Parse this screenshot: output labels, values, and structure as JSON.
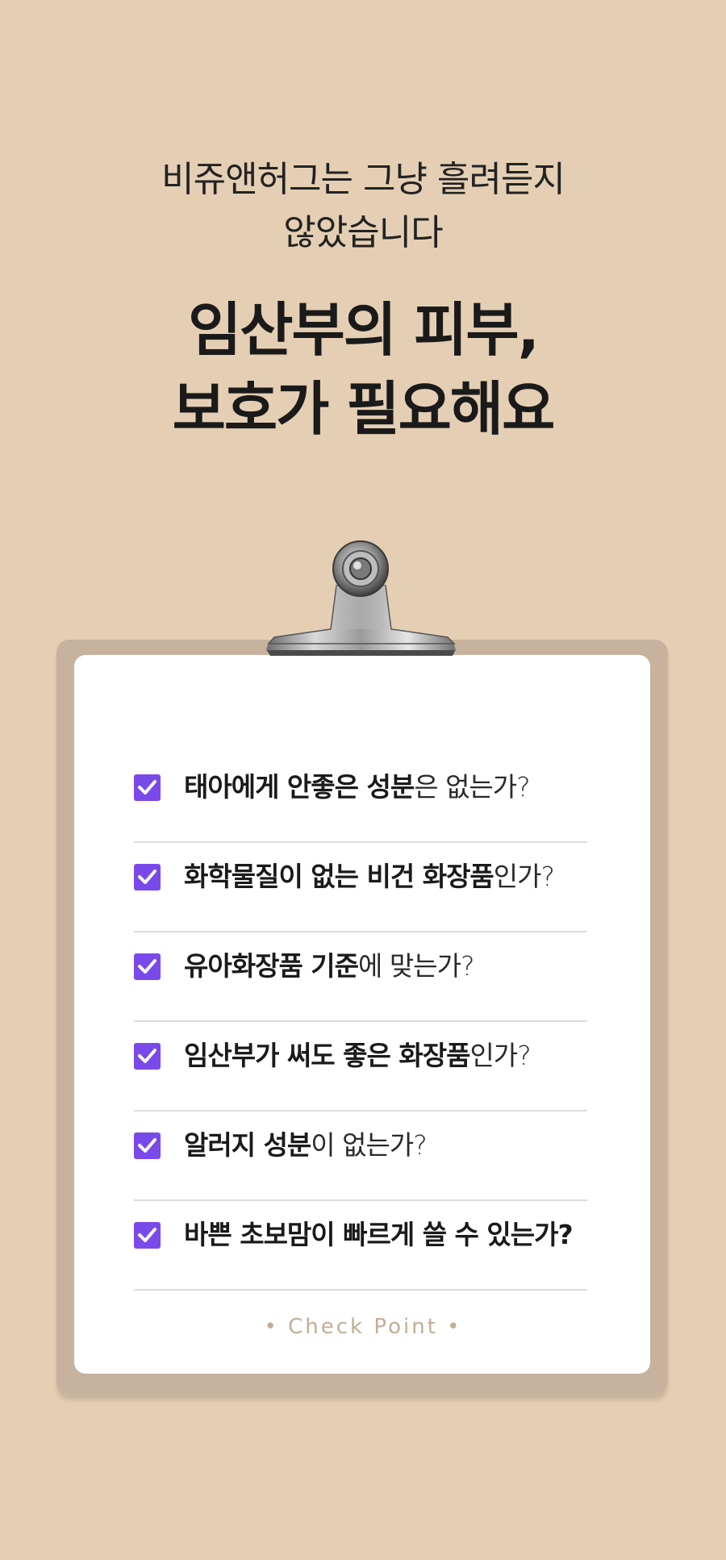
{
  "intro": {
    "line1": "비쥬앤허그는 그냥 흘려듣지",
    "line2": "않았습니다"
  },
  "headline": {
    "line1": "임산부의 피부,",
    "line2": "보호가 필요해요"
  },
  "checklist": {
    "items": [
      {
        "strong": "태아에게 안좋은 성분",
        "rest": "은 없는가?",
        "checked": true
      },
      {
        "strong": "화학물질이 없는 비건 화장품",
        "rest": "인가?",
        "checked": true
      },
      {
        "strong": "유아화장품 기준",
        "rest": "에 맞는가?",
        "checked": true
      },
      {
        "strong": "임산부가 써도 좋은 화장품",
        "rest": "인가?",
        "checked": true
      },
      {
        "strong": "알러지 성분",
        "rest": "이 없는가?",
        "checked": true
      },
      {
        "strong": "바쁜 초보맘이 빠르게 쓸 수 있는가?",
        "rest": "",
        "checked": true
      }
    ],
    "footer": "• Check Point •"
  },
  "colors": {
    "background": "#e5cfb4",
    "board": "#c6b29d",
    "checkbox": "#7a49ea",
    "footer_text": "#c3ad95"
  },
  "icons": {
    "checkbox": "checkmark-icon",
    "clip": "bulldog-clip-icon"
  }
}
